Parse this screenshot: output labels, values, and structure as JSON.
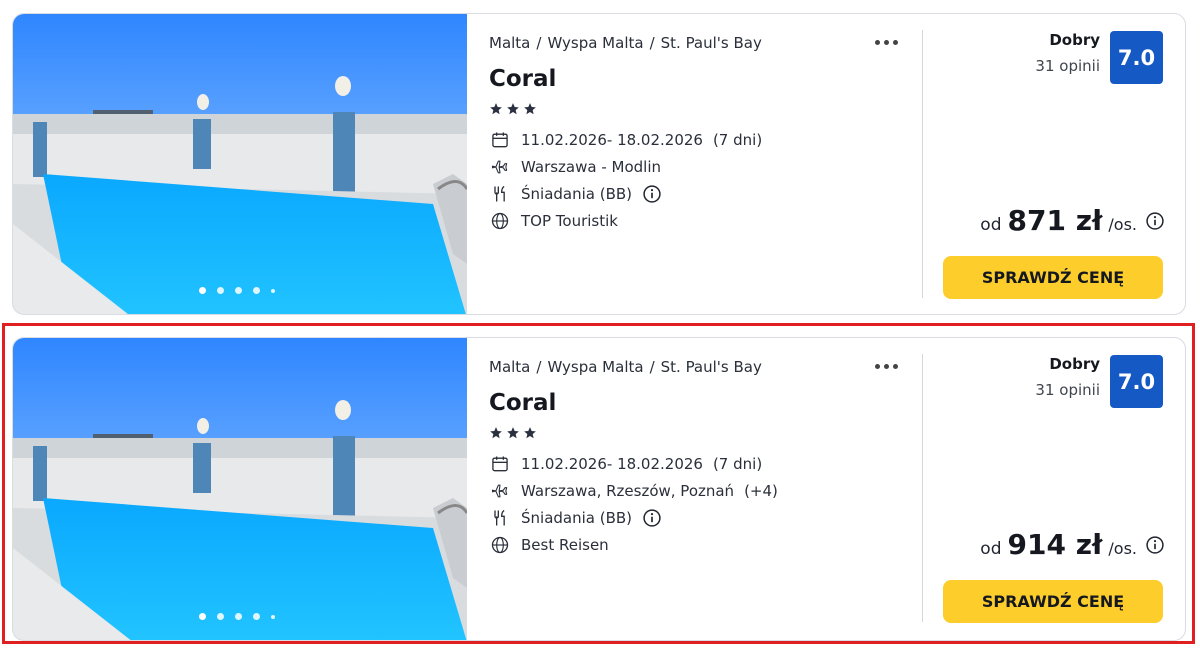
{
  "offers": [
    {
      "breadcrumb": [
        "Malta",
        "/",
        "Wyspa Malta",
        "/",
        "St. Paul's Bay"
      ],
      "name": "Coral",
      "stars": 3,
      "dates": "11.02.2026- 18.02.2026",
      "duration": "(7 dni)",
      "departure": "Warszawa - Modlin",
      "departure_extra": "",
      "board": "Śniadania (BB)",
      "operator": "TOP Touristik",
      "rating_label": "Dobry",
      "rating_count": "31 opinii",
      "score": "7.0",
      "price_prefix": "od",
      "price": "871 zł",
      "price_suffix": "/os.",
      "cta": "SPRAWDŹ CENĘ",
      "photo_dots": 5,
      "active_dot": 0
    },
    {
      "breadcrumb": [
        "Malta",
        "/",
        "Wyspa Malta",
        "/",
        "St. Paul's Bay"
      ],
      "name": "Coral",
      "stars": 3,
      "dates": "11.02.2026- 18.02.2026",
      "duration": "(7 dni)",
      "departure": "Warszawa, Rzeszów, Poznań",
      "departure_extra": "(+4)",
      "board": "Śniadania (BB)",
      "operator": "Best Reisen",
      "rating_label": "Dobry",
      "rating_count": "31 opinii",
      "score": "7.0",
      "price_prefix": "od",
      "price": "914 zł",
      "price_suffix": "/os.",
      "cta": "SPRAWDŹ CENĘ",
      "photo_dots": 5,
      "active_dot": 0
    }
  ],
  "colors": {
    "accent_score": "#1559c5",
    "cta_yellow": "#fdce2b",
    "highlight_red": "#e02020"
  },
  "icons": [
    "heart-icon",
    "more-icon",
    "star-icon",
    "calendar-icon",
    "plane-icon",
    "cutlery-icon",
    "info-icon",
    "globe-icon"
  ]
}
